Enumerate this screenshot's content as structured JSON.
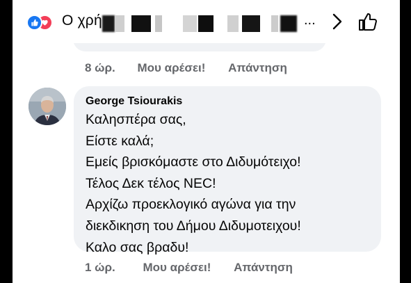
{
  "reaction_bar": {
    "reaction_icons": [
      "like-icon",
      "love-icon"
    ],
    "text_visible": "Ο χρή",
    "text_end": "..."
  },
  "previous_comment": {
    "time": "8 ώρ.",
    "like_label": "Μου αρέσει!",
    "reply_label": "Απάντηση"
  },
  "comment": {
    "author": "George Tsiourakis",
    "lines": [
      "Καλησπέρα σας,",
      "Είστε καλά;",
      "Εμείς βρισκόμαστε στο Διδυμότειχο!",
      "Τέλος Δεκ τέλος NEC!",
      "Αρχίζω προεκλογικό αγώνα για την",
      "διεκδικηση του Δήμου Διδυμοτειχου!",
      "Καλο σας βραδυ!"
    ],
    "time": "1 ώρ.",
    "like_label": "Μου αρέσει!",
    "reply_label": "Απάντηση"
  },
  "colors": {
    "like_blue": "#1877f2",
    "love_red": "#f33e58",
    "meta_gray": "#65676b",
    "bubble_bg": "#f0f2f5"
  }
}
